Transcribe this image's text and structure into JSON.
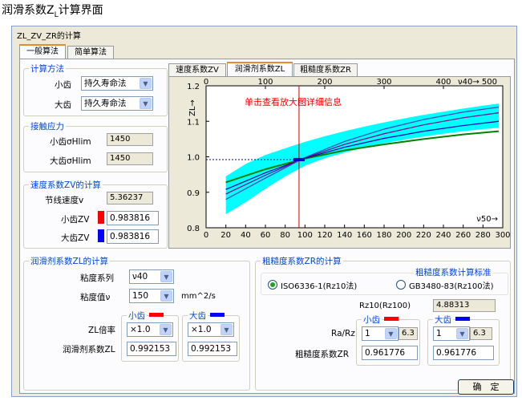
{
  "page_title": "润滑系数Z",
  "page_title_sub": "L",
  "page_title_suffix": "计算界面",
  "window": {
    "title": "ZL_ZV_ZR的计算"
  },
  "tabs": [
    {
      "label": "一般算法",
      "active": true
    },
    {
      "label": "简单算法",
      "active": false
    }
  ],
  "calc_method": {
    "title": "计算方法",
    "small_label": "小齿",
    "small_value": "持久寿命法",
    "large_label": "大齿",
    "large_value": "持久寿命法"
  },
  "contact_stress": {
    "title": "接触应力",
    "small_label": "小齿σHlim",
    "small_value": "1450",
    "large_label": "大齿σHlim",
    "large_value": "1450"
  },
  "zv": {
    "title": "速度系数ZV的计算",
    "speed_label": "节线速度v",
    "speed_value": "5.36237",
    "small_label": "小齿ZV",
    "small_value": "0.983816",
    "large_label": "大齿ZV",
    "large_value": "0.983816"
  },
  "chart_tabs": [
    {
      "label": "速度系数ZV",
      "active": false
    },
    {
      "label": "润滑剂系数ZL",
      "active": true
    },
    {
      "label": "粗糙度系数ZR",
      "active": false
    }
  ],
  "chart_data": {
    "type": "line",
    "title": "单击查看放大图详细信息",
    "ylabel": "ZL",
    "top_axis_label": "ν40→",
    "bottom_axis_label": "ν50→",
    "ylim": [
      0.8,
      1.2
    ],
    "top_xlim": [
      0,
      500
    ],
    "bottom_xlim": [
      0,
      300
    ],
    "top_ticks": [
      0,
      100,
      200,
      300,
      400,
      500
    ],
    "bottom_ticks": [
      0,
      20,
      40,
      60,
      80,
      100,
      120,
      140,
      160,
      180,
      200,
      220,
      240,
      260,
      280,
      300
    ],
    "y_ticks": [
      0.8,
      0.9,
      1.0,
      1.1,
      1.2
    ],
    "marker_x": 94,
    "reference_point": {
      "x": 94,
      "y": 0.9922
    },
    "band": {
      "x": [
        20,
        40,
        60,
        80,
        100,
        120,
        140,
        160,
        180,
        200,
        220,
        240,
        260,
        280,
        296
      ],
      "upper": [
        0.945,
        0.98,
        1.005,
        1.024,
        1.042,
        1.058,
        1.072,
        1.085,
        1.097,
        1.108,
        1.118,
        1.127,
        1.136,
        1.144,
        1.15
      ],
      "lower": [
        0.838,
        0.872,
        0.91,
        0.945,
        0.975,
        0.996,
        1.012,
        1.026,
        1.038,
        1.048,
        1.057,
        1.065,
        1.072,
        1.078,
        1.082
      ]
    },
    "series": [
      {
        "color": "#008000",
        "x": [
          20,
          60,
          100,
          140,
          180,
          220,
          260,
          296
        ],
        "y": [
          0.928,
          0.965,
          0.995,
          1.018,
          1.035,
          1.05,
          1.063,
          1.072
        ]
      },
      {
        "color": "#0000aa",
        "x": [
          20,
          60,
          100,
          140,
          180,
          220,
          260,
          296
        ],
        "y": [
          0.908,
          0.955,
          0.996,
          1.027,
          1.052,
          1.072,
          1.088,
          1.1
        ]
      },
      {
        "color": "#800080",
        "x": [
          20,
          60,
          100,
          140,
          180,
          220,
          260,
          296
        ],
        "y": [
          0.895,
          0.948,
          0.997,
          1.035,
          1.065,
          1.09,
          1.11,
          1.124
        ]
      },
      {
        "color": "#4040c0",
        "x": [
          20,
          60,
          100,
          140,
          180,
          220,
          260,
          296
        ],
        "y": [
          0.88,
          0.94,
          0.998,
          1.043,
          1.078,
          1.105,
          1.126,
          1.14
        ]
      }
    ],
    "colors": {
      "band": "#00ffff",
      "marker": "#cc0000",
      "grid": "#000000"
    }
  },
  "zl": {
    "title": "润滑剂系数ZL的计算",
    "viscosity_series_label": "粘度系列",
    "viscosity_series_value": "ν40",
    "viscosity_label": "粘度值ν",
    "viscosity_value": "150",
    "viscosity_unit": "mm^2/s",
    "small_header": "小齿",
    "large_header": "大齿",
    "ratio_label": "ZL倍率",
    "small_ratio": "×1.0",
    "large_ratio": "×1.0",
    "coef_label": "润滑剂系数ZL",
    "small_coef": "0.992153",
    "large_coef": "0.992153"
  },
  "zr": {
    "title": "粗糙度系数ZR的计算",
    "standard_title": "粗糙度系数计算标准",
    "option1": "ISO6336-1(Rz10法)",
    "option2": "GB3480-83(Rz100法)",
    "rz_label": "Rz10(Rz100)",
    "rz_value": "4.88313",
    "small_header": "小齿",
    "large_header": "大齿",
    "ratio_label": "Ra/Rz",
    "small_ratio": "1",
    "small_ratio_value": "6.3",
    "large_ratio": "1",
    "large_ratio_value": "6.3",
    "coef_label": "粗糙度系数ZR",
    "small_coef": "0.961776",
    "large_coef": "0.961776"
  },
  "colors": {
    "small": "#ff0000",
    "large": "#0000ff"
  },
  "ok_button": "确　定"
}
